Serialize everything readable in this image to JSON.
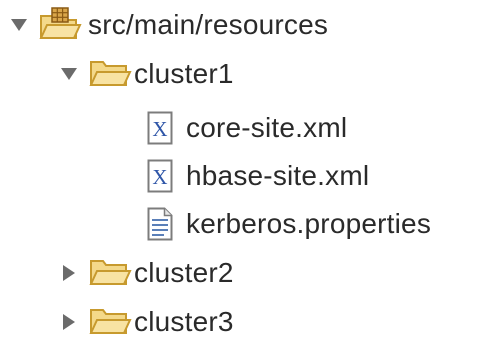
{
  "tree": {
    "items": [
      {
        "label": "src/main/resources",
        "icon": "source-folder-icon",
        "expanded": true
      },
      {
        "label": "cluster1",
        "icon": "folder-open-icon",
        "expanded": true
      },
      {
        "label": "core-site.xml",
        "icon": "xml-file-icon"
      },
      {
        "label": "hbase-site.xml",
        "icon": "xml-file-icon"
      },
      {
        "label": "kerberos.properties",
        "icon": "properties-file-icon"
      },
      {
        "label": "cluster2",
        "icon": "folder-open-icon",
        "expanded": false
      },
      {
        "label": "cluster3",
        "icon": "folder-open-icon",
        "expanded": false
      }
    ]
  },
  "colors": {
    "folder_fill": "#f4d98a",
    "folder_stroke": "#c79a2e",
    "twisty": "#6b6b6b",
    "xml_letter": "#2f56a8",
    "text": "#2a2a2a"
  }
}
